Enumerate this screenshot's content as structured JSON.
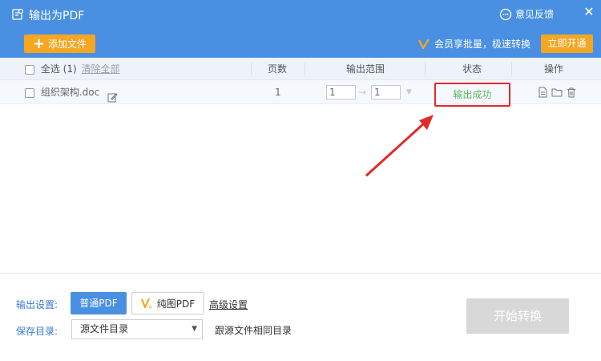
{
  "window": {
    "title": "输出为PDF",
    "feedback_label": "意见反馈",
    "close_glyph": "✕"
  },
  "toolbar": {
    "add_file_label": "添加文件",
    "add_file_glyph": "+",
    "vip_promo": "会员享批量，极速转换",
    "vip_button": "立即开通"
  },
  "table": {
    "headers": {
      "select_all": "全选 (1)",
      "clear_all": "清除全部",
      "pages": "页数",
      "range": "输出范围",
      "status": "状态",
      "actions": "操作"
    },
    "rows": [
      {
        "filename": "组织架构.doc",
        "pages": "1",
        "range_from": "1",
        "range_to": "1",
        "range_separator": "→",
        "status": "输出成功"
      }
    ]
  },
  "settings": {
    "output_label": "输出设置:",
    "mode_normal": "普通PDF",
    "mode_pure": "纯图PDF",
    "advanced": "高级设置",
    "save_label": "保存目录:",
    "save_dir_value": "源文件目录",
    "save_dir_hint": "跟源文件相同目录",
    "start_button": "开始转换"
  },
  "colors": {
    "header_blue": "#4a90e2",
    "accent_orange": "#f5a623",
    "success_green": "#5bb85b",
    "annotation_red": "#e02a2a"
  }
}
